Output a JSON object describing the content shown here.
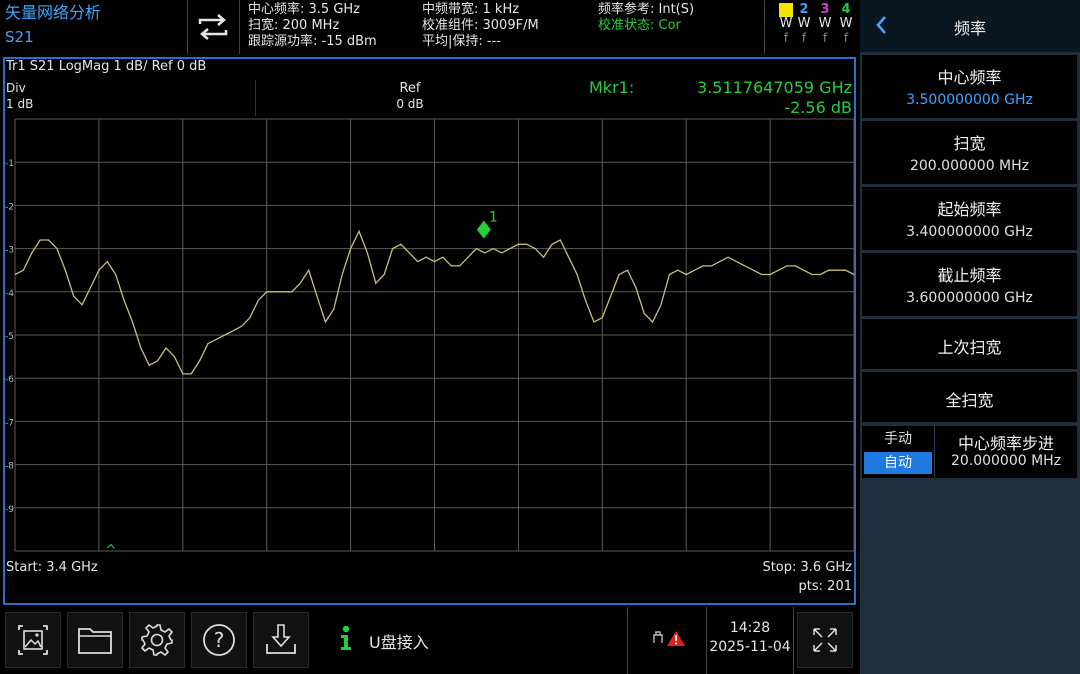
{
  "header": {
    "title": "矢量网络分析",
    "param": "S21",
    "center_freq": "中心频率: 3.5 GHz",
    "span": "扫宽: 200 MHz",
    "track_power": "跟踪源功率: -15 dBm",
    "if_bw": "中频带宽: 1 kHz",
    "cal_kit": "校准组件: 3009F/M",
    "avg_hold": "平均|保持: ---",
    "freq_ref": "频率参考: Int(S)",
    "cal_status": "校准状态: Cor",
    "traces": [
      {
        "num": "1",
        "mode": "W",
        "det": "f",
        "color": "#f2e600"
      },
      {
        "num": "2",
        "mode": "W",
        "det": "f",
        "color": "#3aa0ff"
      },
      {
        "num": "3",
        "mode": "W",
        "det": "f",
        "color": "#d040d0"
      },
      {
        "num": "4",
        "mode": "W",
        "det": "f",
        "color": "#22c840"
      }
    ]
  },
  "plot": {
    "trace_label": "Tr1 S21 LogMag 1 dB/ Ref 0 dB",
    "div_label": "Div",
    "div_value": "1 dB",
    "ref_label": "Ref",
    "ref_value": "0 dB",
    "marker_label": "Mkr1:",
    "marker_freq": "3.5117647059 GHz",
    "marker_value": "-2.56 dB",
    "marker_num": "1",
    "start": "Start: 3.4 GHz",
    "stop": "Stop: 3.6 GHz",
    "points": "pts: 201",
    "y_ticks": [
      "-1",
      "-2",
      "-3",
      "-4",
      "-5",
      "-6",
      "-7",
      "-8",
      "-9"
    ],
    "ref_caret": "^"
  },
  "chart_data": {
    "type": "line",
    "x_range_ghz": [
      3.4,
      3.6
    ],
    "ylim": [
      -10,
      0
    ],
    "grid": true,
    "series": [
      {
        "color": "#c8c07a",
        "x_ghz": [
          3.4,
          3.402,
          3.404,
          3.406,
          3.408,
          3.41,
          3.412,
          3.414,
          3.416,
          3.418,
          3.42,
          3.422,
          3.424,
          3.426,
          3.428,
          3.43,
          3.432,
          3.434,
          3.436,
          3.438,
          3.44,
          3.442,
          3.444,
          3.446,
          3.448,
          3.45,
          3.452,
          3.454,
          3.456,
          3.458,
          3.46,
          3.462,
          3.464,
          3.466,
          3.468,
          3.47,
          3.472,
          3.474,
          3.476,
          3.478,
          3.48,
          3.482,
          3.484,
          3.486,
          3.488,
          3.49,
          3.492,
          3.494,
          3.496,
          3.498,
          3.5,
          3.502,
          3.504,
          3.506,
          3.508,
          3.51,
          3.512,
          3.514,
          3.516,
          3.518,
          3.52,
          3.522,
          3.524,
          3.526,
          3.528,
          3.53,
          3.532,
          3.534,
          3.536,
          3.538,
          3.54,
          3.542,
          3.544,
          3.546,
          3.548,
          3.55,
          3.552,
          3.554,
          3.556,
          3.558,
          3.56,
          3.562,
          3.564,
          3.566,
          3.568,
          3.57,
          3.572,
          3.574,
          3.576,
          3.578,
          3.58,
          3.582,
          3.584,
          3.586,
          3.588,
          3.59,
          3.592,
          3.594,
          3.596,
          3.598,
          3.6
        ],
        "y_db": [
          -3.6,
          -3.5,
          -3.1,
          -2.8,
          -2.8,
          -3.0,
          -3.5,
          -4.1,
          -4.3,
          -3.9,
          -3.5,
          -3.3,
          -3.6,
          -4.2,
          -4.7,
          -5.3,
          -5.7,
          -5.6,
          -5.3,
          -5.5,
          -5.9,
          -5.9,
          -5.6,
          -5.2,
          -5.1,
          -5.0,
          -4.9,
          -4.8,
          -4.6,
          -4.2,
          -4.0,
          -4.0,
          -4.0,
          -4.0,
          -3.8,
          -3.5,
          -4.1,
          -4.7,
          -4.4,
          -3.6,
          -3.0,
          -2.6,
          -3.1,
          -3.8,
          -3.6,
          -3.0,
          -2.9,
          -3.1,
          -3.3,
          -3.2,
          -3.3,
          -3.2,
          -3.4,
          -3.4,
          -3.2,
          -3.0,
          -3.1,
          -3.0,
          -3.1,
          -3.0,
          -2.9,
          -2.9,
          -3.0,
          -3.2,
          -2.9,
          -2.8,
          -3.2,
          -3.6,
          -4.2,
          -4.7,
          -4.6,
          -4.1,
          -3.6,
          -3.5,
          -3.9,
          -4.5,
          -4.7,
          -4.3,
          -3.6,
          -3.5,
          -3.6,
          -3.5,
          -3.4,
          -3.4,
          -3.3,
          -3.2,
          -3.3,
          -3.4,
          -3.5,
          -3.6,
          -3.6,
          -3.5,
          -3.4,
          -3.4,
          -3.5,
          -3.6,
          -3.6,
          -3.5,
          -3.5,
          -3.5,
          -3.6
        ]
      }
    ],
    "marker": {
      "label": "1",
      "x_ghz": 3.5117647059,
      "y_db": -2.56
    }
  },
  "right_panel": {
    "title": "频率",
    "items": [
      {
        "label": "中心频率",
        "value": "3.500000000 GHz",
        "value_color": "#3ea6ff"
      },
      {
        "label": "扫宽",
        "value": "200.000000 MHz",
        "value_color": "#e0e0e0"
      },
      {
        "label": "起始频率",
        "value": "3.400000000 GHz",
        "value_color": "#e0e0e0"
      },
      {
        "label": "截止频率",
        "value": "3.600000000 GHz",
        "value_color": "#e0e0e0"
      },
      {
        "label": "上次扫宽",
        "value": "",
        "value_color": "#e0e0e0"
      },
      {
        "label": "全扫宽",
        "value": "",
        "value_color": "#e0e0e0"
      }
    ],
    "step": {
      "manual": "手动",
      "auto": "自动",
      "label": "中心频率步进",
      "value": "20.000000 MHz"
    }
  },
  "bottom": {
    "usb_msg": "U盘接入",
    "time": "14:28",
    "date": "2025-11-04",
    "icons": [
      "screenshot-icon",
      "folder-icon",
      "settings-icon",
      "help-icon",
      "download-icon"
    ]
  }
}
